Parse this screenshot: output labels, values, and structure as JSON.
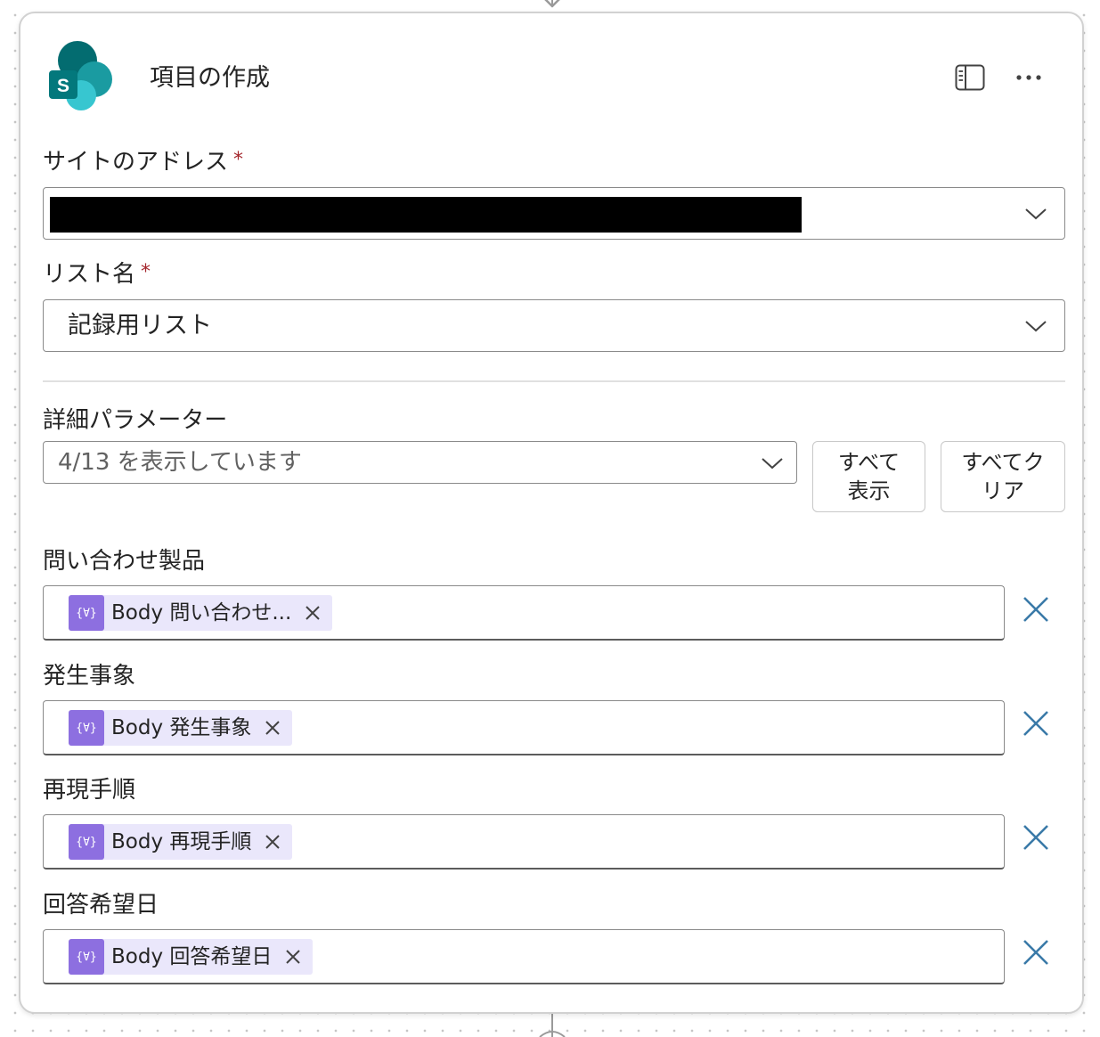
{
  "card": {
    "title": "項目の作成",
    "logo_letter": "S"
  },
  "site_address": {
    "label": "サイトのアドレス",
    "required_mark": "*",
    "value": ""
  },
  "list_name": {
    "label": "リスト名",
    "required_mark": "*",
    "value": "記録用リスト"
  },
  "advanced": {
    "label": "詳細パラメーター",
    "dropdown_value": "4/13 を表示しています",
    "show_all_line1": "すべて",
    "show_all_line2": "表示",
    "clear_all_line1": "すべてク",
    "clear_all_line2": "リア"
  },
  "fields": [
    {
      "label": "問い合わせ製品",
      "token": "Body 問い合わせ..."
    },
    {
      "label": "発生事象",
      "token": "Body 発生事象"
    },
    {
      "label": "再現手順",
      "token": "Body 再現手順"
    },
    {
      "label": "回答希望日",
      "token": "Body 回答希望日"
    }
  ],
  "icons": {
    "token_icon_glyph": "{∀}",
    "panel": "panel-icon",
    "more": "more-icon",
    "chevron": "chevron-down-icon",
    "close": "close-icon"
  },
  "colors": {
    "sharepoint_teal": "#03787c",
    "token_bg": "#eae7fb",
    "token_icon_bg": "#8d6fe0",
    "remove_x": "#3a7aa8",
    "required": "#a4262c"
  }
}
